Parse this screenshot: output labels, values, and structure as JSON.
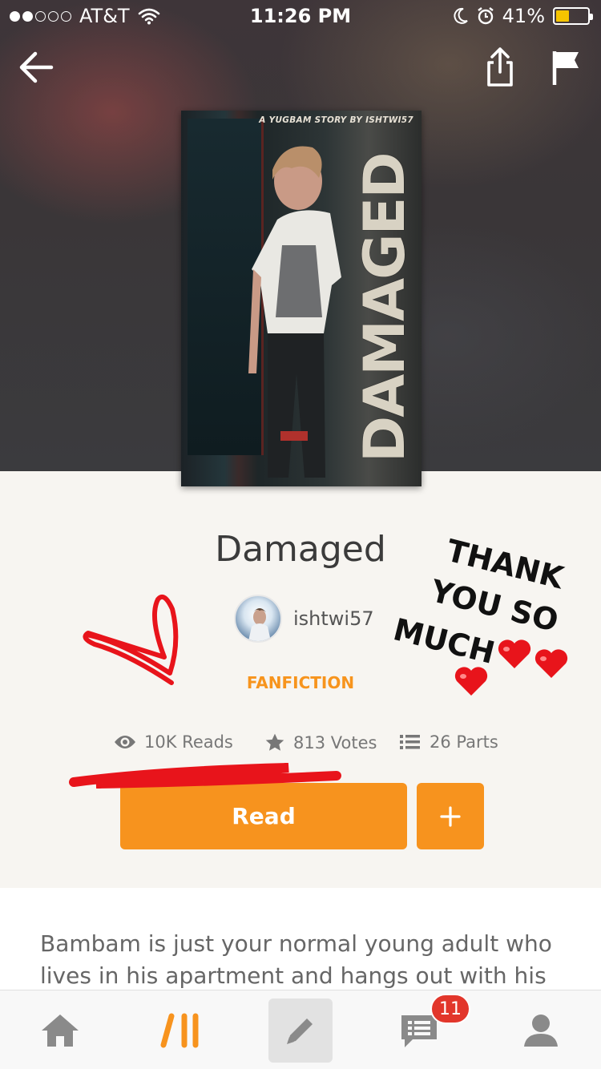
{
  "status_bar": {
    "carrier": "AT&T",
    "time": "11:26 PM",
    "battery": "41%",
    "battery_level": 0.41,
    "signal_bars": 2,
    "signal_total": 5
  },
  "cover": {
    "kicker": "A YUGBAM STORY BY ISHTWI57",
    "title": "DAMAGED"
  },
  "story": {
    "title": "Damaged",
    "author": "ishtwi57",
    "category": "FANFICTION"
  },
  "stats": {
    "reads": "10K Reads",
    "votes": "813 Votes",
    "parts": "26 Parts"
  },
  "actions": {
    "read_label": "Read",
    "add_label": "+"
  },
  "description": "Bambam is just your normal young adult who lives in his apartment and hangs out with his",
  "annotation": {
    "line1": "THANK",
    "line2": "YOU SO",
    "line3": "MUCH"
  },
  "tabbar": {
    "notifications_badge": "11"
  },
  "colors": {
    "accent": "#f7931e",
    "badge": "#e2362b",
    "annotation_red": "#e8141b"
  },
  "icons": [
    "back-arrow-icon",
    "share-icon",
    "flag-icon",
    "eye-icon",
    "star-icon",
    "list-icon",
    "home-icon",
    "discover-icon",
    "pencil-icon",
    "chat-icon",
    "profile-icon"
  ]
}
